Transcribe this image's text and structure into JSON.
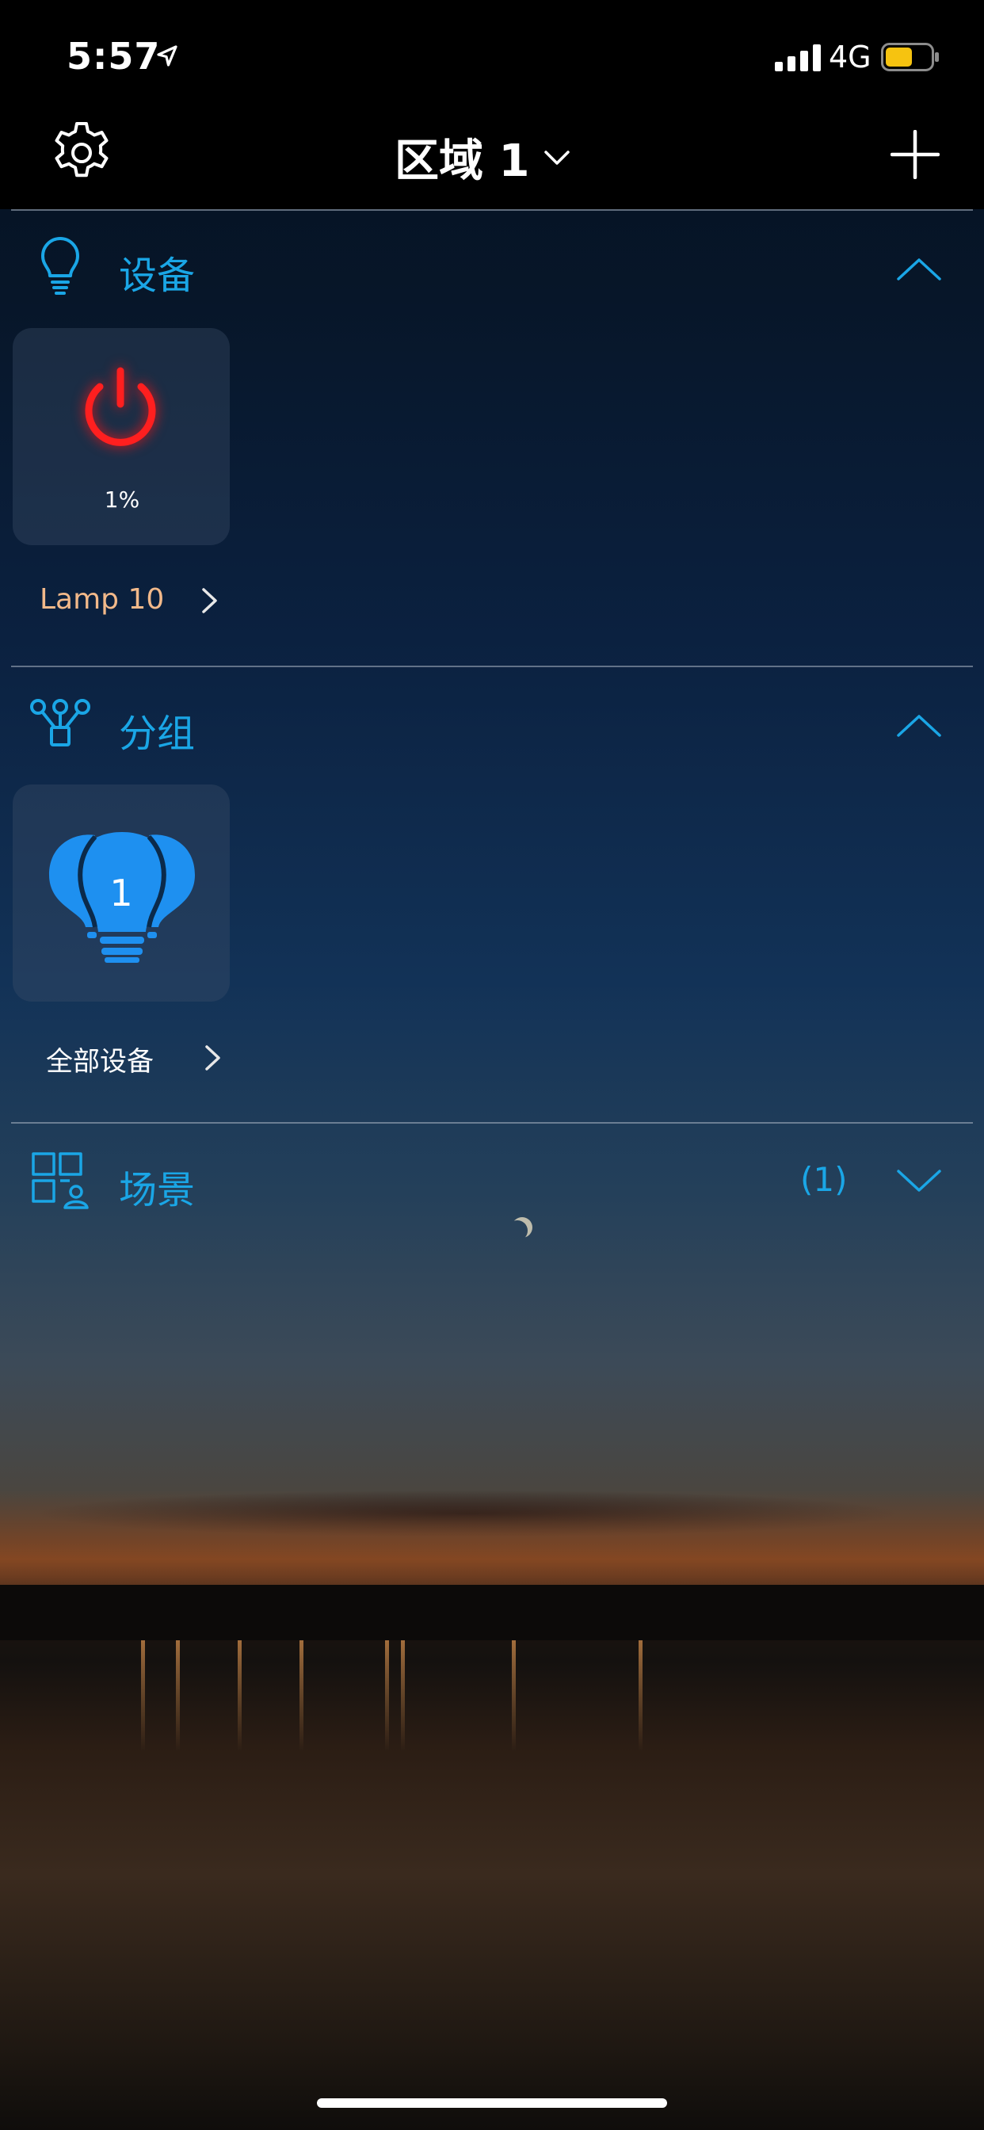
{
  "status_bar": {
    "time": "5:57",
    "carrier": "4G",
    "icons": [
      "location-arrow-icon",
      "signal-bars-icon",
      "battery-icon"
    ],
    "battery_color": "#f6c310"
  },
  "nav": {
    "title": "区域 1",
    "left_icon": "gear-icon",
    "right_icon": "plus-icon",
    "title_icon": "chevron-down-icon"
  },
  "sections": {
    "devices": {
      "title": "设备",
      "icon": "lightbulb-outline-icon",
      "state": "expanded",
      "items": [
        {
          "name": "Lamp 10",
          "value": "1%",
          "icon": "power-icon",
          "name_color": "#f2b98a",
          "icon_color": "#ff1f1f"
        }
      ]
    },
    "groups": {
      "title": "分组",
      "icon": "group-tree-icon",
      "state": "expanded",
      "items": [
        {
          "name": "全部设备",
          "badge": "1",
          "icon": "bulb-group-icon",
          "icon_color": "#1e90f0"
        }
      ]
    },
    "scenes": {
      "title": "场景",
      "icon": "scene-grid-icon",
      "count": "(1)",
      "state": "collapsed"
    }
  },
  "colors": {
    "accent": "#1aa6e6",
    "background_top": "#05101f"
  }
}
